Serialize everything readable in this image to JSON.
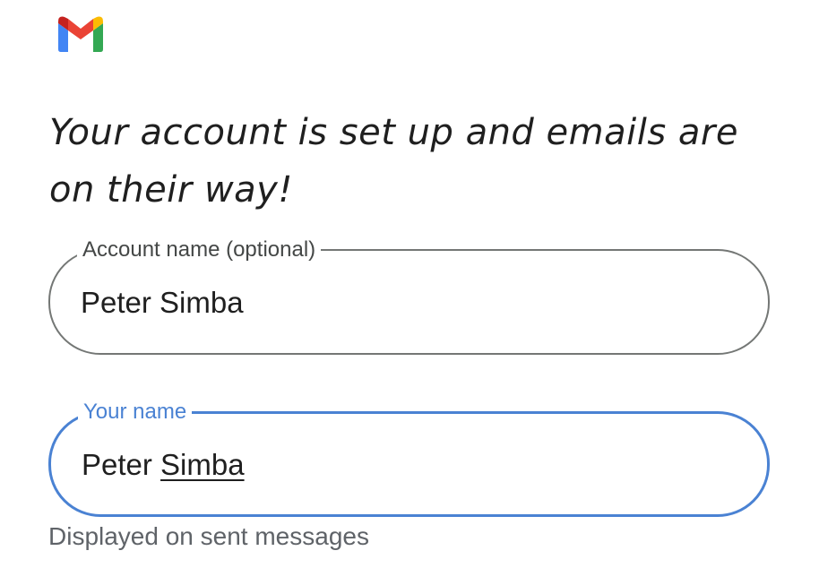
{
  "app": {
    "logo_icon": "gmail-logo-icon",
    "brand_colors": {
      "blue": "#4285F4",
      "red": "#EA4335",
      "yellow": "#FBBC04",
      "green": "#34A853",
      "dark_red": "#C5221F"
    }
  },
  "headline": "Your account is set up and emails are on their way!",
  "account_name_field": {
    "label": "Account name (optional)",
    "value": "Peter Simba"
  },
  "your_name_field": {
    "label": "Your name",
    "value_first": "Peter",
    "value_last": "Simba",
    "helper_text": "Displayed on sent messages",
    "focus_color": "#4a82d3"
  }
}
